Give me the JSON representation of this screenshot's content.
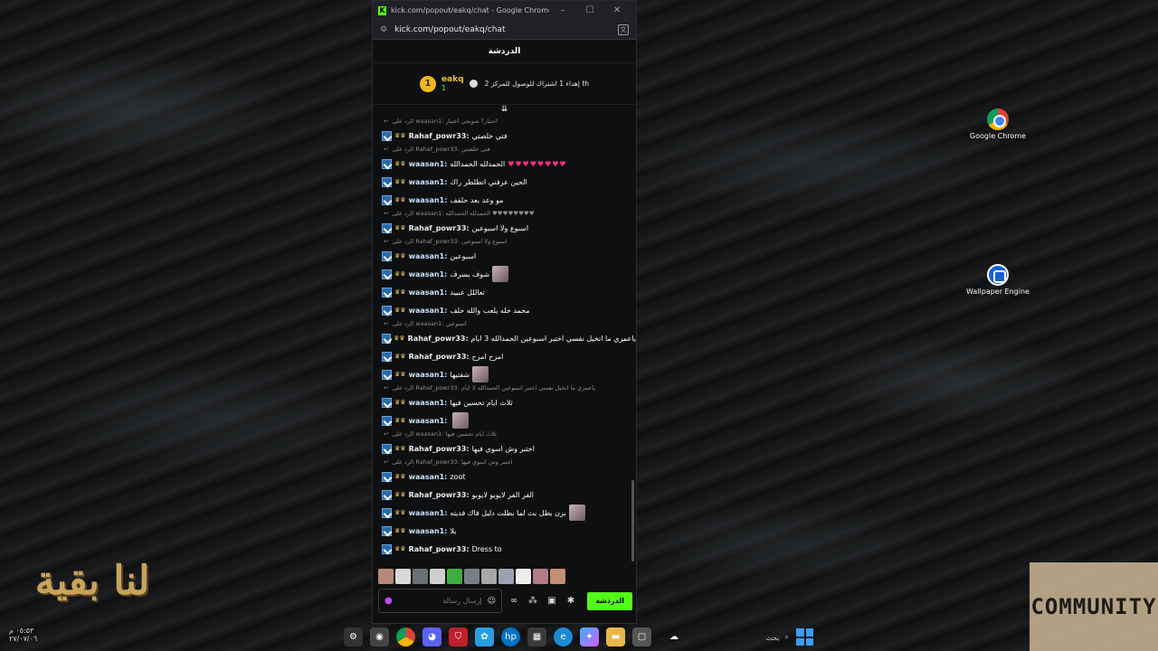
{
  "window": {
    "title": "kick.com/popout/eakq/chat - Google Chrome",
    "url": "kick.com/popout/eakq/chat",
    "favicon": "K"
  },
  "chat": {
    "header": "الدردشة",
    "pinned": {
      "gifter_name": "eakq",
      "gifter_count": "1",
      "rank": "1",
      "goal_text": "إهداء 1 اشتراك للوصول للمركز 2 th"
    },
    "messages": [
      {
        "reply": "الرد على waasan1: اختيار؟ شويجي اختيار",
        "user": "Rahaf_powr33:",
        "text": "فتي خلصتي",
        "cls": "u-rahaf"
      },
      {
        "reply": "الرد على Rahaf_powr33: فتي خلصتي",
        "user": "waasan1:",
        "text": "الحمدلله الحمدالله",
        "hearts": "♥♥♥♥♥♥♥♥",
        "cls": "u-waasan"
      },
      {
        "user": "waasan1:",
        "text": "الحين عرفني اتطلطر راك",
        "cls": "u-waasan"
      },
      {
        "user": "waasan1:",
        "text": "مو وعد بعد حلقف",
        "cls": "u-waasan"
      },
      {
        "reply": "الرد على waasan1: الحمدلله الحمدالله ♥♥♥♥♥♥♥♥",
        "user": "Rahaf_powr33:",
        "text": "اسبوع ولا اسبوعين",
        "cls": "u-rahaf"
      },
      {
        "reply": "الرد على Rahaf_powr33: اسبوع ولا اسبوعين",
        "user": "waasan1:",
        "text": "اسبوعين",
        "cls": "u-waasan"
      },
      {
        "user": "waasan1:",
        "text": "شوف يسرف",
        "emote": true,
        "cls": "u-waasan"
      },
      {
        "user": "waasan1:",
        "text": "تعاللل عبييد",
        "cls": "u-waasan"
      },
      {
        "user": "waasan1:",
        "text": "محمد خله يلعب والله حلف",
        "cls": "u-waasan"
      },
      {
        "reply": "الرد على waasan1: اسبوعين",
        "user": "Rahaf_powr33:",
        "text": "ياعمري ما اتخيل نفسي اختبر اسبوعين الحمدالله 3 ايام",
        "cls": "u-rahaf"
      },
      {
        "user": "Rahaf_powr33:",
        "text": "امزح امزح",
        "cls": "u-rahaf"
      },
      {
        "user": "waasan1:",
        "text": "شفتيها",
        "emote": true,
        "cls": "u-waasan"
      },
      {
        "reply": "الرد على Rahaf_powr33: ياعمري ما اتخيل نفسي اختبر اسبوعين الحمدالله 3 ايام",
        "user": "waasan1:",
        "text": "ثلاث ايام تحسين فيها",
        "cls": "u-waasan"
      },
      {
        "user": "waasan1:",
        "text": "",
        "emote": true,
        "cls": "u-waasan"
      },
      {
        "reply": "الرد على waasan1: ثلاث ايام تحسين فيها",
        "user": "Rahaf_powr33:",
        "text": "اختبر وش اسوي فيها",
        "cls": "u-rahaf"
      },
      {
        "reply": "الرد على Rahaf_powr33: اختبر وش اسوي فيها",
        "user": "waasan1:",
        "text": "zoot",
        "cls": "u-waasan"
      },
      {
        "user": "Rahaf_powr33:",
        "text": "الفر الفر لايوبو لايوبو",
        "cls": "u-rahaf"
      },
      {
        "user": "waasan1:",
        "text": "بزن بطل بث لما بطلت دليل فاك فديته",
        "emote": true,
        "cls": "u-waasan"
      },
      {
        "user": "waasan1:",
        "text": "يلا",
        "cls": "u-waasan"
      },
      {
        "user": "Rahaf_powr33:",
        "text": "Dress to",
        "cls": "u-rahaf"
      }
    ],
    "input_placeholder": "إرسال رسالة",
    "send_label": "الدردشة"
  },
  "desktop": {
    "icons": [
      {
        "label": "Google Chrome"
      },
      {
        "label": "Wallpaper Engine"
      }
    ],
    "left_logo": "لنا بقية",
    "left_stamp_time": "٠٥:٥٣ م",
    "left_stamp_date": "٢٧/٠٧/٠٦",
    "right_logo": "COMMUNITY"
  },
  "taskbar": {
    "search_label": "بحث"
  },
  "colors": {
    "kick_green": "#53fc18",
    "heart": "#ff2e7e",
    "gold": "#f2b91d"
  }
}
